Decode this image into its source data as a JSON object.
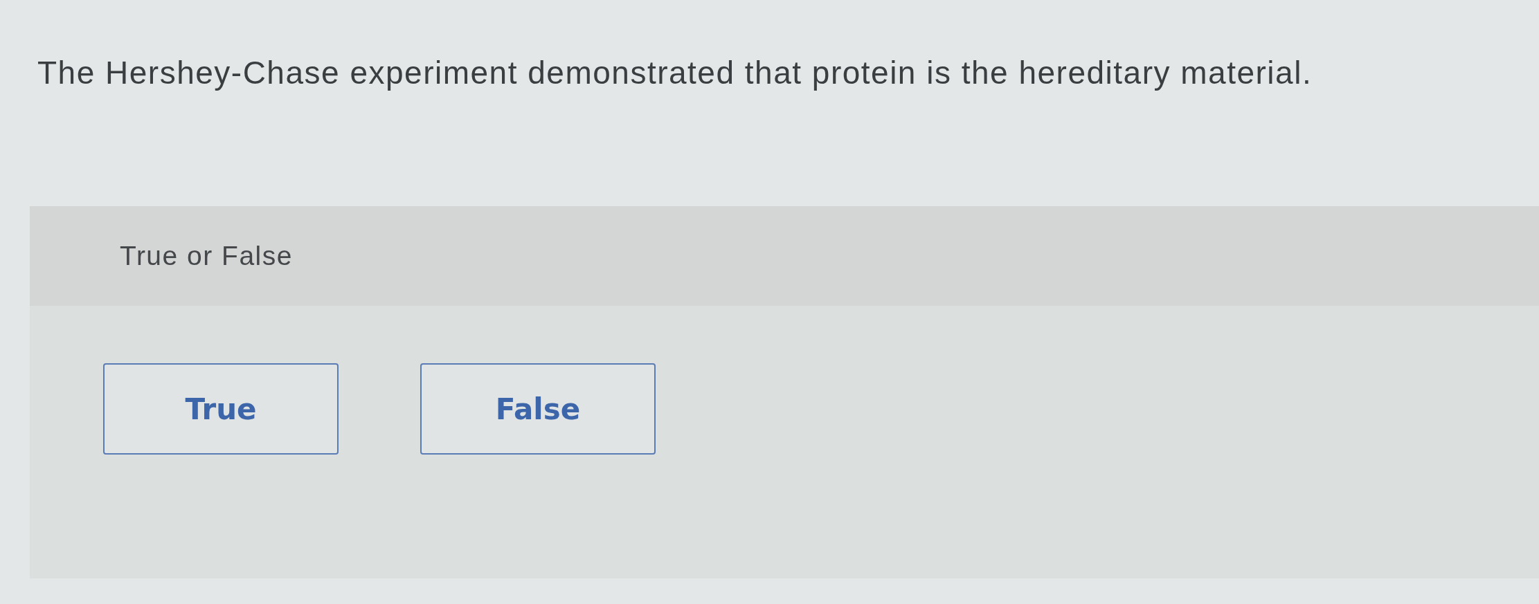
{
  "question": {
    "text": "The Hershey-Chase experiment demonstrated that protein is the hereditary material."
  },
  "answer_panel": {
    "prompt": "True or False",
    "options": [
      {
        "label": "True",
        "selected": false
      },
      {
        "label": "False",
        "selected": false
      }
    ]
  }
}
